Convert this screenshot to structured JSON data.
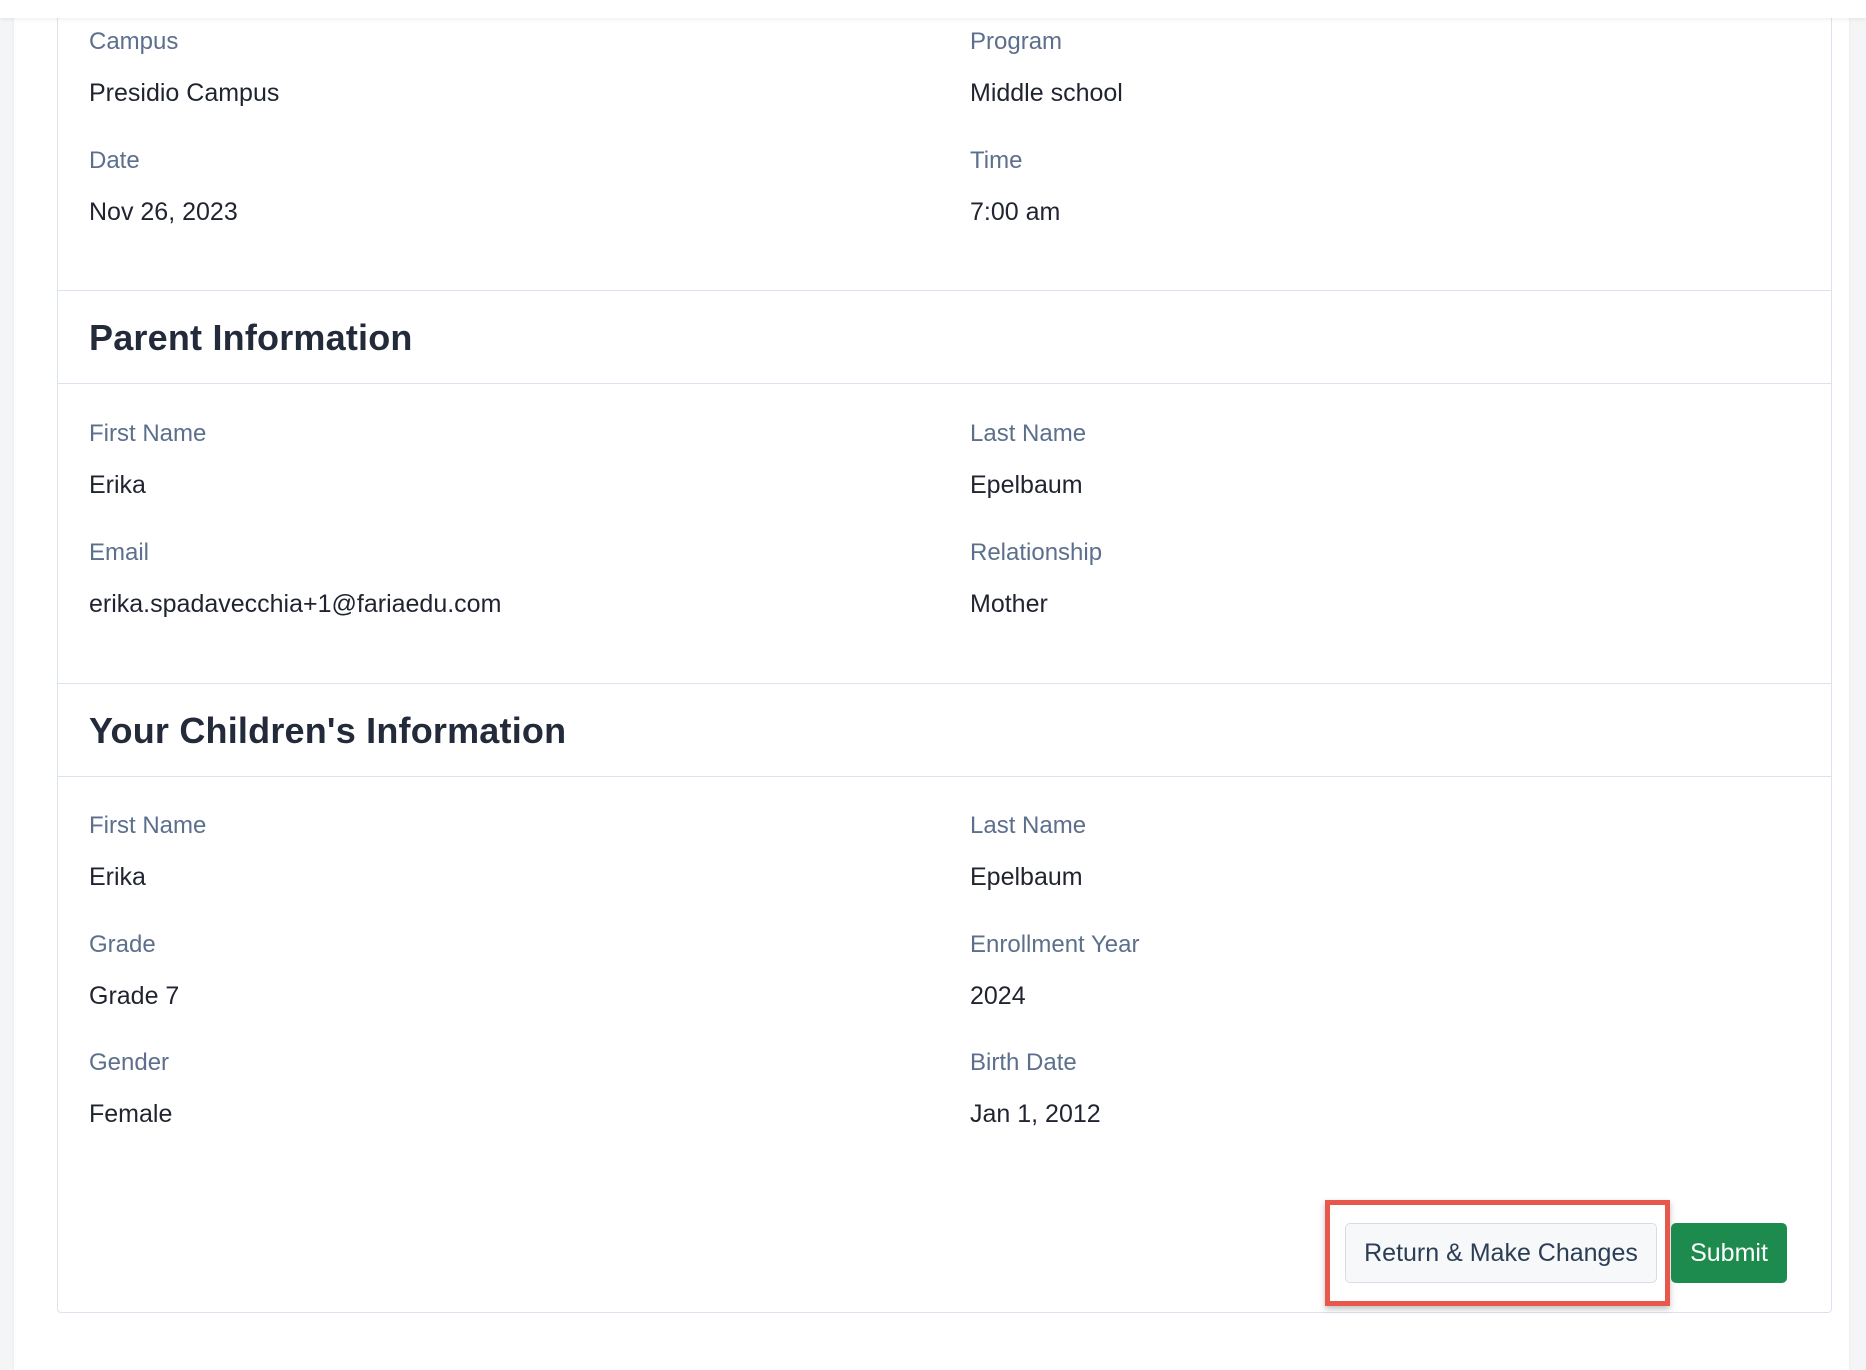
{
  "appointment": {
    "campus_label": "Campus",
    "campus_value": "Presidio Campus",
    "program_label": "Program",
    "program_value": "Middle school",
    "date_label": "Date",
    "date_value": "Nov 26, 2023",
    "time_label": "Time",
    "time_value": "7:00 am"
  },
  "parent": {
    "title": "Parent Information",
    "first_name_label": "First Name",
    "first_name_value": "Erika",
    "last_name_label": "Last Name",
    "last_name_value": "Epelbaum",
    "email_label": "Email",
    "email_value": "erika.spadavecchia+1@fariaedu.com",
    "relationship_label": "Relationship",
    "relationship_value": "Mother"
  },
  "children": {
    "title": "Your Children's Information",
    "first_name_label": "First Name",
    "first_name_value": "Erika",
    "last_name_label": "Last Name",
    "last_name_value": "Epelbaum",
    "grade_label": "Grade",
    "grade_value": "Grade 7",
    "enrollment_year_label": "Enrollment Year",
    "enrollment_year_value": "2024",
    "gender_label": "Gender",
    "gender_value": "Female",
    "birth_date_label": "Birth Date",
    "birth_date_value": "Jan 1, 2012"
  },
  "actions": {
    "return_label": "Return & Make Changes",
    "submit_label": "Submit"
  },
  "colors": {
    "submit_bg": "#1d8a4e",
    "highlight": "#e8574b"
  }
}
